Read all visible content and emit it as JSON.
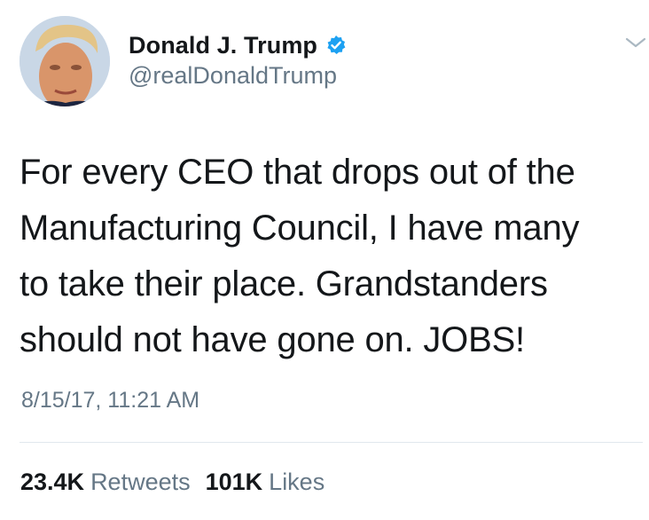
{
  "author": {
    "display_name": "Donald J. Trump",
    "handle": "@realDonaldTrump",
    "verified": true,
    "avatar_icon": "profile-photo"
  },
  "tweet": {
    "text": "For every CEO that drops out of the\nManufacturing Council, I have many\nto take their place. Grandstanders\nshould not have gone on. JOBS!",
    "timestamp": "8/15/17, 11:21 AM"
  },
  "stats": {
    "retweets_count": "23.4K",
    "retweets_label": "Retweets",
    "likes_count": "101K",
    "likes_label": "Likes"
  },
  "colors": {
    "text_primary": "#14171a",
    "text_secondary": "#657786",
    "verified_blue": "#1da1f2",
    "divider": "#e1e8ed"
  }
}
